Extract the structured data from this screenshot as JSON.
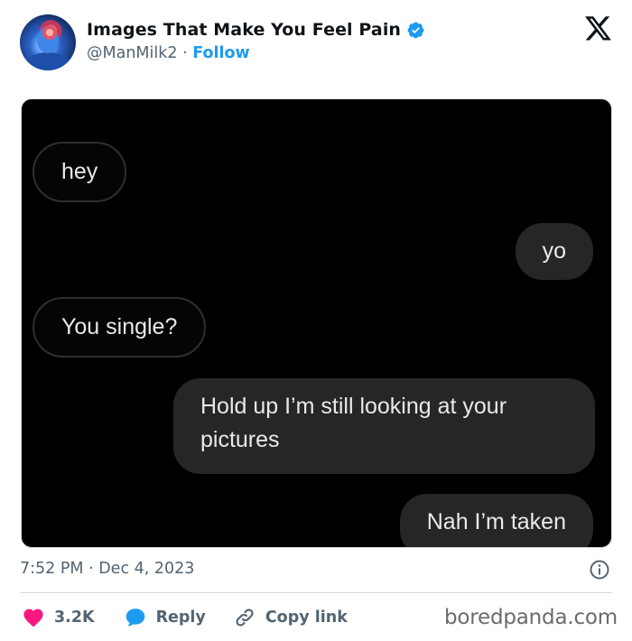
{
  "account": {
    "name": "Images That Make You Feel Pain",
    "handle": "@ManMilk2",
    "separator": "·",
    "follow_label": "Follow"
  },
  "icons": {
    "verified": "verified-badge-icon",
    "platform": "x-logo-icon",
    "info": "info-icon",
    "like": "heart-icon",
    "reply": "speech-bubble-icon",
    "copy": "link-icon"
  },
  "messages": [
    {
      "text": "hey",
      "side": "incoming"
    },
    {
      "text": "yo",
      "side": "outgoing"
    },
    {
      "text": "You single?",
      "side": "incoming"
    },
    {
      "text": "Hold up I’m still looking at your pictures",
      "side": "outgoing"
    },
    {
      "text": "Nah I’m taken",
      "side": "outgoing"
    }
  ],
  "timestamp": "7:52 PM · Dec 4, 2023",
  "actions": {
    "like_count": "3.2K",
    "reply_label": "Reply",
    "copy_label": "Copy link"
  },
  "watermark": "boredpanda.com",
  "colors": {
    "like": "#f91880",
    "reply": "#1d9bf0",
    "follow": "#1d9bf0",
    "verified": "#1d9bf0"
  }
}
